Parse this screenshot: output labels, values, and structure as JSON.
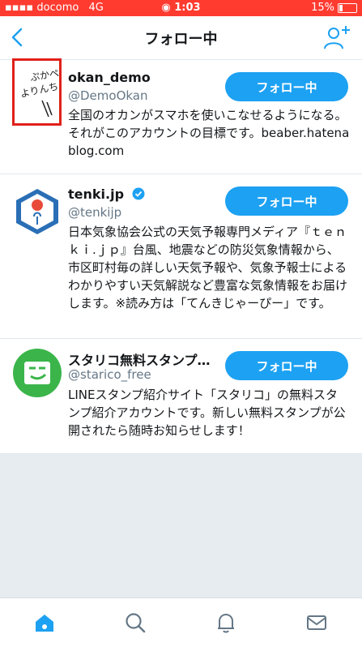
{
  "status_bar": {
    "carrier": "docomo",
    "network": "4G",
    "time": "1:03",
    "battery": "15%"
  },
  "header": {
    "title": "フォロー中",
    "back_icon": "chevron-left-icon",
    "add_user_icon": "add-user-icon"
  },
  "users": [
    {
      "name": "okan_demo",
      "handle": "@DemoOkan",
      "verified": false,
      "bio": "全国のオカンがスマホを使いこなせるようになる。それがこのアカウントの目標です。beaber.hatenablog.com",
      "follow_label": "フォロー中",
      "avatar_text": "ぷかぺ よりんちゃ"
    },
    {
      "name": "tenki.jp",
      "handle": "@tenkijp",
      "verified": true,
      "bio": "日本気象協会公式の天気予報専門メディア『ｔｅｎｋｉ.ｊｐ』台風、地震などの防災気象情報から、市区町村毎の詳しい天気予報や、気象予報士によるわかりやすい天気解説など豊富な気象情報をお届けします。※読み方は「てんきじゃーぴー」です。",
      "follow_label": "フォロー中"
    },
    {
      "name": "スタリコ無料スタンプ…",
      "handle": "@starico_free",
      "verified": false,
      "bio": "LINEスタンプ紹介サイト「スタリコ」の無料スタンプ紹介アカウントです。新しい無料スタンプが公開されたら随時お知らせします！",
      "follow_label": "フォロー中"
    }
  ],
  "tab_bar": {
    "tabs": [
      "home-icon",
      "search-icon",
      "notifications-icon",
      "messages-icon"
    ],
    "active": "home-icon"
  },
  "colors": {
    "status_bar": "#ff3b30",
    "accent": "#1da1f2",
    "highlight": "#e0201a"
  }
}
